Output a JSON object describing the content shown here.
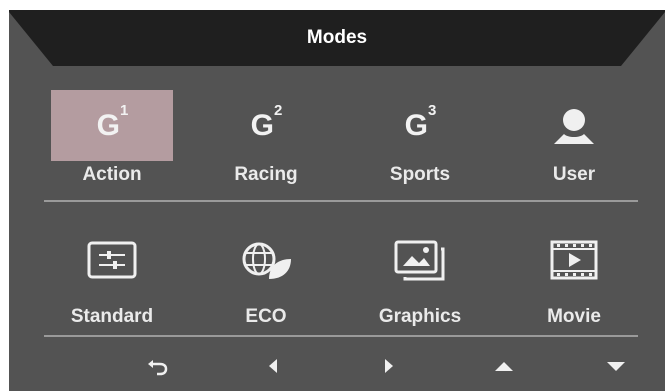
{
  "title": "Modes",
  "modes_row1": [
    {
      "label": "Action",
      "icon": "g1-icon",
      "glyph": "G",
      "sup": "1",
      "selected": true
    },
    {
      "label": "Racing",
      "icon": "g2-icon",
      "glyph": "G",
      "sup": "2",
      "selected": false
    },
    {
      "label": "Sports",
      "icon": "g3-icon",
      "glyph": "G",
      "sup": "3",
      "selected": false
    },
    {
      "label": "User",
      "icon": "user-icon",
      "selected": false
    }
  ],
  "modes_row2": [
    {
      "label": "Standard",
      "icon": "sliders-icon"
    },
    {
      "label": "ECO",
      "icon": "globe-leaf-icon"
    },
    {
      "label": "Graphics",
      "icon": "graphics-icon"
    },
    {
      "label": "Movie",
      "icon": "film-icon"
    }
  ],
  "nav": [
    "return-icon",
    "left-arrow-icon",
    "right-arrow-icon",
    "up-arrow-icon",
    "down-arrow-icon"
  ],
  "colors": {
    "panel": "#535353",
    "title_bar": "#1f1f1f",
    "selected": "#b49ca0",
    "text": "#eaeaea"
  }
}
